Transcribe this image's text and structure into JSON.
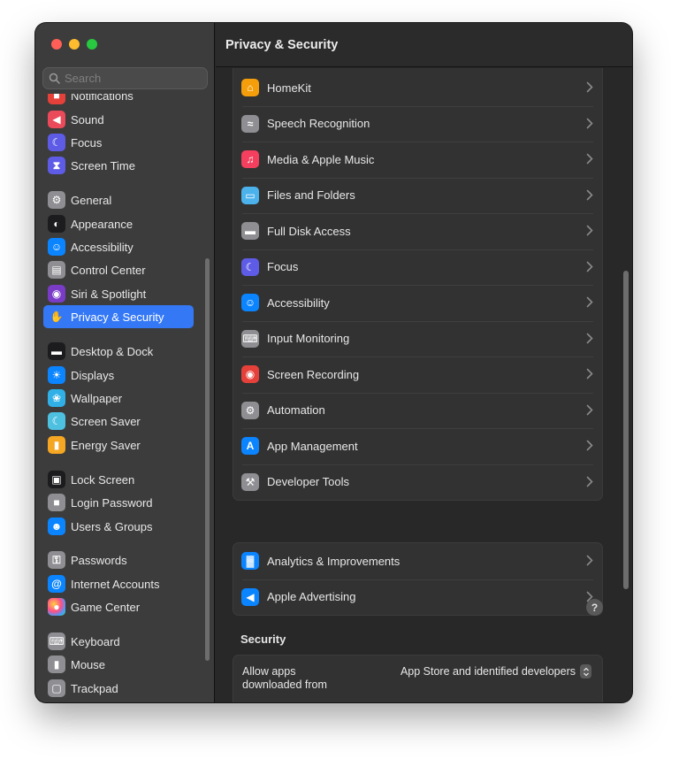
{
  "window": {
    "title": "Privacy & Security"
  },
  "search": {
    "placeholder": "Search"
  },
  "sidebar": {
    "items": [
      {
        "label": "Notifications",
        "icon": "notifications-icon",
        "color": "#e5413a"
      },
      {
        "label": "Sound",
        "icon": "speaker-icon",
        "color": "#ea4a5a"
      },
      {
        "label": "Focus",
        "icon": "moon-icon",
        "color": "#5e5ce6"
      },
      {
        "label": "Screen Time",
        "icon": "hourglass-icon",
        "color": "#5e5ce6"
      },
      {
        "label": "General",
        "icon": "gear-icon",
        "color": "#8e8e93"
      },
      {
        "label": "Appearance",
        "icon": "appearance-icon",
        "color": "#1c1c1e"
      },
      {
        "label": "Accessibility",
        "icon": "accessibility-icon",
        "color": "#0a84ff"
      },
      {
        "label": "Control Center",
        "icon": "control-center-icon",
        "color": "#8e8e93"
      },
      {
        "label": "Siri & Spotlight",
        "icon": "siri-icon",
        "color": "#7a3cc7"
      },
      {
        "label": "Privacy & Security",
        "icon": "hand-icon",
        "color": "#3478f6"
      },
      {
        "label": "Desktop & Dock",
        "icon": "dock-icon",
        "color": "#1c1c1e"
      },
      {
        "label": "Displays",
        "icon": "sun-icon",
        "color": "#0a84ff"
      },
      {
        "label": "Wallpaper",
        "icon": "wallpaper-icon",
        "color": "#30b0e6"
      },
      {
        "label": "Screen Saver",
        "icon": "screen-saver-icon",
        "color": "#4ec0e0"
      },
      {
        "label": "Energy Saver",
        "icon": "battery-icon",
        "color": "#f5a623"
      },
      {
        "label": "Lock Screen",
        "icon": "lock-screen-icon",
        "color": "#1c1c1e"
      },
      {
        "label": "Login Password",
        "icon": "lock-icon",
        "color": "#8e8e93"
      },
      {
        "label": "Users & Groups",
        "icon": "users-icon",
        "color": "#0a84ff"
      },
      {
        "label": "Passwords",
        "icon": "key-icon",
        "color": "#8e8e93"
      },
      {
        "label": "Internet Accounts",
        "icon": "at-icon",
        "color": "#0a84ff"
      },
      {
        "label": "Game Center",
        "icon": "game-center-icon",
        "color": "#e8e8e8"
      },
      {
        "label": "Keyboard",
        "icon": "keyboard-icon",
        "color": "#8e8e93"
      },
      {
        "label": "Mouse",
        "icon": "mouse-icon",
        "color": "#8e8e93"
      },
      {
        "label": "Trackpad",
        "icon": "trackpad-icon",
        "color": "#8e8e93"
      }
    ]
  },
  "privacy_list": [
    {
      "label": "HomeKit",
      "icon": "home-icon",
      "color": "#f59e0b"
    },
    {
      "label": "Speech Recognition",
      "icon": "waveform-icon",
      "color": "#8e8e93"
    },
    {
      "label": "Media & Apple Music",
      "icon": "music-note-icon",
      "color": "#f43f5e"
    },
    {
      "label": "Files and Folders",
      "icon": "folder-icon",
      "color": "#4cb2ec"
    },
    {
      "label": "Full Disk Access",
      "icon": "disk-icon",
      "color": "#8e8e93"
    },
    {
      "label": "Focus",
      "icon": "moon-icon",
      "color": "#5e5ce6"
    },
    {
      "label": "Accessibility",
      "icon": "accessibility-icon",
      "color": "#0a84ff"
    },
    {
      "label": "Input Monitoring",
      "icon": "keyboard-icon",
      "color": "#8e8e93"
    },
    {
      "label": "Screen Recording",
      "icon": "record-icon",
      "color": "#e5413a"
    },
    {
      "label": "Automation",
      "icon": "gears-icon",
      "color": "#8e8e93"
    },
    {
      "label": "App Management",
      "icon": "app-store-icon",
      "color": "#0a84ff"
    },
    {
      "label": "Developer Tools",
      "icon": "hammer-icon",
      "color": "#8e8e93"
    }
  ],
  "analytics_list": [
    {
      "label": "Analytics & Improvements",
      "icon": "chart-icon",
      "color": "#0a84ff"
    },
    {
      "label": "Apple Advertising",
      "icon": "megaphone-icon",
      "color": "#0a84ff"
    }
  ],
  "help": {
    "label": "?"
  },
  "security": {
    "title": "Security",
    "allow_label": "Allow apps downloaded from",
    "allow_value": "App Store and identified developers"
  }
}
